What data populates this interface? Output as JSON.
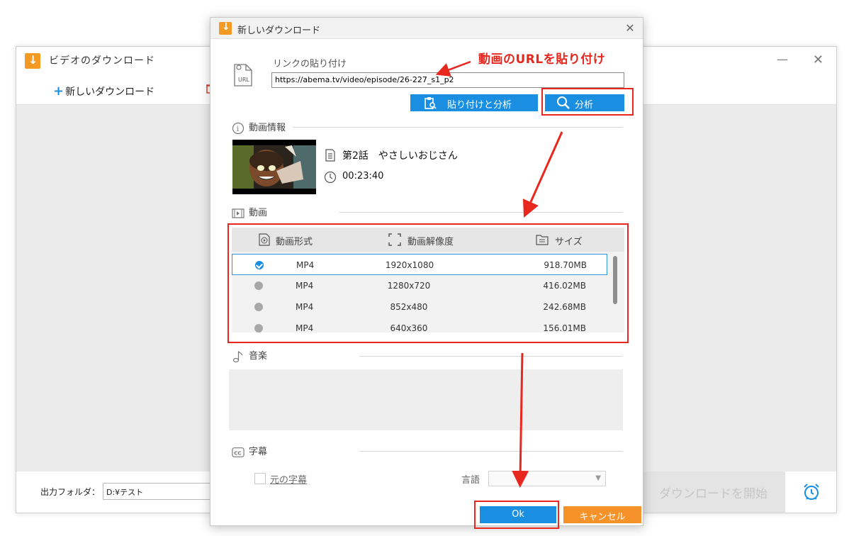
{
  "main_window": {
    "title": "ビデオのダウンロード",
    "min_glyph": "—",
    "close_glyph": "✕",
    "toolbar": {
      "new_download_label": "新しいダウンロード",
      "plus_glyph": "+"
    },
    "footer": {
      "output_folder_label": "出力フォルダ：",
      "output_folder_value": "D:¥テスト",
      "start_download_label": "ダウンロードを開始"
    }
  },
  "dialog": {
    "title": "新しいダウンロード",
    "close_glyph": "✕",
    "url": {
      "label": "リンクの貼り付け",
      "value": "https://abema.tv/video/episode/26-227_s1_p2",
      "icon_text": "URL"
    },
    "annotation_text": "動画のURLを貼り付け",
    "buttons": {
      "paste_analyze": "貼り付けと分析",
      "analyze": "分析",
      "ok": "Ok",
      "cancel": "キャンセル"
    },
    "video_info": {
      "section_label": "動画情報",
      "title": "第2話　やさしいおじさん",
      "duration": "00:23:40"
    },
    "video": {
      "section_label": "動画",
      "columns": {
        "format": "動画形式",
        "resolution": "動画解像度",
        "size": "サイズ"
      },
      "rows": [
        {
          "format": "MP4",
          "resolution": "1920x1080",
          "size": "918.70MB",
          "selected": true
        },
        {
          "format": "MP4",
          "resolution": "1280x720",
          "size": "416.02MB",
          "selected": false
        },
        {
          "format": "MP4",
          "resolution": "852x480",
          "size": "242.68MB",
          "selected": false
        },
        {
          "format": "MP4",
          "resolution": "640x360",
          "size": "156.01MB",
          "selected": false
        }
      ]
    },
    "music": {
      "section_label": "音楽"
    },
    "subtitles": {
      "section_label": "字幕",
      "icon_text": "CC",
      "original_subs_label": "元の字幕",
      "language_label": "言語",
      "language_value": ""
    }
  },
  "colors": {
    "accent_blue": "#1a8ee0",
    "cancel_orange": "#f5932a",
    "annotation_red": "#e8271e",
    "logo_orange": "#f39a25"
  }
}
